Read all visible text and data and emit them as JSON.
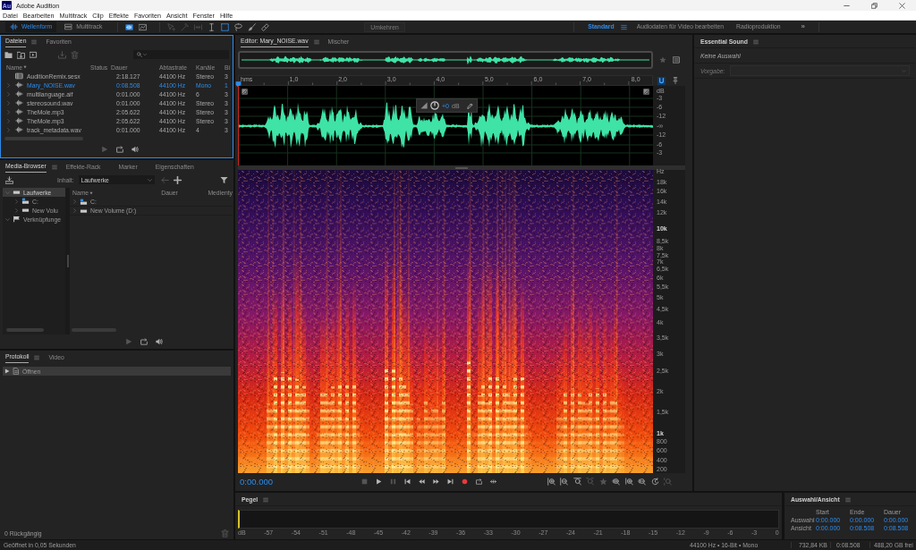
{
  "window": {
    "logo": "Au",
    "title": "Adobe Audition"
  },
  "menu": [
    "Datei",
    "Bearbeiten",
    "Multitrack",
    "Clip",
    "Effekte",
    "Favoriten",
    "Ansicht",
    "Fenster",
    "Hilfe"
  ],
  "toolbar": {
    "modes": [
      {
        "kind": "waveform",
        "label": "Wellenform",
        "selected": true
      },
      {
        "kind": "multitrack",
        "label": "Multitrack",
        "selected": false
      }
    ],
    "views": [
      {
        "kind": "waveform_view",
        "selected": true
      },
      {
        "kind": "spectral_view",
        "selected": false
      }
    ],
    "tools": [
      {
        "kind": "move",
        "selected": false,
        "disabled": true
      },
      {
        "kind": "razor",
        "selected": false,
        "disabled": true
      },
      {
        "kind": "slip",
        "selected": false,
        "disabled": true
      },
      {
        "kind": "time_select",
        "selected": false,
        "disabled": false
      },
      {
        "kind": "marquee",
        "selected": true,
        "disabled": false
      },
      {
        "kind": "lasso",
        "selected": false,
        "disabled": false
      },
      {
        "kind": "brush",
        "selected": false,
        "disabled": false
      },
      {
        "kind": "heal",
        "selected": false,
        "disabled": false
      }
    ],
    "dimmed_button": "Umkehren",
    "workspaces": [
      {
        "label": "Standard",
        "selected": true
      },
      {
        "label": "Audiodaten für Video bearbeiten",
        "selected": false
      },
      {
        "label": "Radioproduktion",
        "selected": false
      }
    ],
    "workspace_more": "»"
  },
  "files_panel": {
    "focused": true,
    "tabs": [
      {
        "label": "Dateien",
        "selected": true
      },
      {
        "label": "Favoriten",
        "selected": false
      }
    ],
    "columns": [
      "Name",
      "Status",
      "Dauer",
      "Abtastrate",
      "Kanäle",
      "Bi"
    ],
    "rows": [
      {
        "kind": "session",
        "name": "AuditionRemix.sesx",
        "duration": "2:18.127",
        "rate": "44100 Hz",
        "channels": "Stereo",
        "bits": "3",
        "selected": false
      },
      {
        "kind": "audio",
        "name": "Mary_NOISE.wav",
        "duration": "0:08.508",
        "rate": "44100 Hz",
        "channels": "Mono",
        "bits": "1",
        "selected": true
      },
      {
        "kind": "audio",
        "name": "multilanguage.aif",
        "duration": "0:01.000",
        "rate": "44100 Hz",
        "channels": "6",
        "bits": "3",
        "selected": false
      },
      {
        "kind": "audio",
        "name": "stereosound.wav",
        "duration": "0:01.000",
        "rate": "44100 Hz",
        "channels": "Stereo",
        "bits": "3",
        "selected": false
      },
      {
        "kind": "audio",
        "name": "TheMole.mp3",
        "duration": "2:05.622",
        "rate": "44100 Hz",
        "channels": "Stereo",
        "bits": "3",
        "selected": false
      },
      {
        "kind": "audio",
        "name": "TheMole.mp3",
        "duration": "2:05.622",
        "rate": "44100 Hz",
        "channels": "Stereo",
        "bits": "3",
        "selected": false
      },
      {
        "kind": "audio",
        "name": "track_metadata.wav",
        "duration": "0:01.000",
        "rate": "44100 Hz",
        "channels": "4",
        "bits": "3",
        "selected": false
      }
    ]
  },
  "media_browser": {
    "tabs": [
      {
        "label": "Media-Browser",
        "selected": true
      },
      {
        "label": "Effekte-Rack",
        "selected": false
      },
      {
        "label": "Marker",
        "selected": false
      },
      {
        "label": "Eigenschaften",
        "selected": false
      }
    ],
    "content_label": "Inhalt:",
    "content_value": "Laufwerke",
    "tree": [
      {
        "kind": "drives",
        "label": "Laufwerke",
        "expanded": true,
        "selected": true,
        "children": [
          {
            "kind": "system_drive",
            "label": "C:",
            "expanded": false,
            "selected": false
          },
          {
            "kind": "drive",
            "label": "New Volu",
            "expanded": false,
            "selected": false
          }
        ]
      },
      {
        "kind": "shortcuts",
        "label": "Verknüpfunge",
        "expanded": true,
        "selected": false
      }
    ],
    "columns": [
      "Name",
      "Dauer",
      "Medienty"
    ],
    "rows": [
      {
        "kind": "system_drive",
        "name": "C:",
        "expanded": false
      },
      {
        "kind": "drive",
        "name": "New Volume (D:)",
        "expanded": false
      }
    ]
  },
  "history_panel": {
    "tabs": [
      {
        "label": "Protokoll",
        "selected": true
      },
      {
        "label": "Video",
        "selected": false
      }
    ],
    "items": [
      {
        "label": "Öffnen",
        "selected": true
      }
    ],
    "undo": "0 Rückgängig"
  },
  "editor": {
    "tabs": [
      {
        "label": "Editor: Mary_NOISE.wav",
        "selected": true
      },
      {
        "label": "Mischer",
        "selected": false
      }
    ],
    "snap": true,
    "ruler": [
      "hms",
      "1,0",
      "2,0",
      "3,0",
      "4,0",
      "5,0",
      "6,0",
      "7,0",
      "8,0"
    ],
    "gain_value": "+0",
    "gain_unit": "dB",
    "db_scale": [
      "dB",
      "-3",
      "-6",
      "-12",
      "-∞",
      "-12",
      "-6",
      "-3"
    ],
    "hz_scale": [
      {
        "label": "Hz",
        "major": false
      },
      {
        "label": "18k",
        "major": false
      },
      {
        "label": "16k",
        "major": false
      },
      {
        "label": "14k",
        "major": false
      },
      {
        "label": "12k",
        "major": false
      },
      {
        "label": "10k",
        "major": true
      },
      {
        "label": "8,5k",
        "major": false
      },
      {
        "label": "8k",
        "major": false
      },
      {
        "label": "7,5k",
        "major": false
      },
      {
        "label": "7k",
        "major": false
      },
      {
        "label": "6,5k",
        "major": false
      },
      {
        "label": "6k",
        "major": false
      },
      {
        "label": "5,5k",
        "major": false
      },
      {
        "label": "5k",
        "major": false
      },
      {
        "label": "4,5k",
        "major": false
      },
      {
        "label": "4k",
        "major": false
      },
      {
        "label": "3,5k",
        "major": false
      },
      {
        "label": "3k",
        "major": false
      },
      {
        "label": "2,5k",
        "major": false
      },
      {
        "label": "2k",
        "major": false
      },
      {
        "label": "1,5k",
        "major": false
      },
      {
        "label": "1k",
        "major": true
      },
      {
        "label": "800",
        "major": false
      },
      {
        "label": "600",
        "major": false
      },
      {
        "label": "400",
        "major": false
      },
      {
        "label": "200",
        "major": false
      }
    ],
    "time": "0:00.000"
  },
  "essential_sound": {
    "title": "Essential Sound",
    "status": "Keine Auswahl",
    "preset_label": "Vorgabe:"
  },
  "levels_panel": {
    "title": "Pegel",
    "scale": [
      "dB",
      "-57",
      "-54",
      "-51",
      "-48",
      "-45",
      "-42",
      "-39",
      "-36",
      "-33",
      "-30",
      "-27",
      "-24",
      "-21",
      "-18",
      "-15",
      "-12",
      "-9",
      "-6",
      "-3",
      "0"
    ]
  },
  "selection_panel": {
    "title": "Auswahl/Ansicht",
    "columns": [
      "Start",
      "Ende",
      "Dauer"
    ],
    "rows": [
      {
        "label": "Auswahl",
        "values": [
          "0:00.000",
          "0:00.000",
          "0:00.000"
        ]
      },
      {
        "label": "Ansicht",
        "values": [
          "0:00.000",
          "0:08.508",
          "0:08.508"
        ]
      }
    ]
  },
  "status_bar": {
    "message": "Geöffnet in 0,05 Sekunden",
    "format": "44100 Hz • 16-Bit • Mono",
    "size": "732,84 KB",
    "duration": "0:08.508",
    "free": "488,20 GB frei"
  }
}
